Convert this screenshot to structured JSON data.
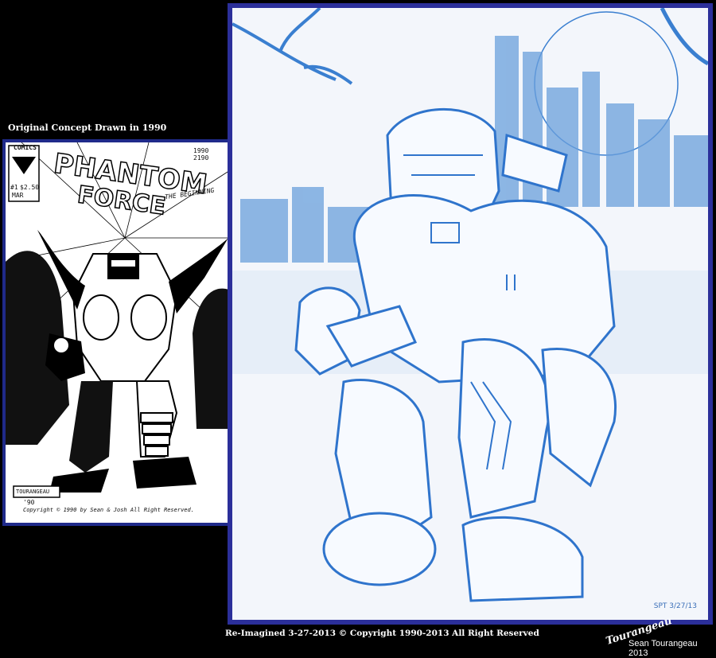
{
  "captions": {
    "top": "Original Concept Drawn in 1990",
    "bottom": "Re-Imagined 3-27-2013 © Copyright 1990-2013 All Right Reserved",
    "signature": "Tourangeau",
    "credit": "Sean Tourangeau 2013"
  },
  "original_cover": {
    "publisher": "COMICS",
    "issue_no": "#1",
    "price": "$2.50",
    "month": "MAR",
    "date_note": "1990 2190",
    "title_line1": "PHANTOM",
    "title_line2": "FORCE",
    "subtitle": "THE BEGINNING",
    "signature_box": "TOURANGEAU",
    "year_mark": "'90",
    "copyright": "Copyright © 1990 by Sean & Josh All Right Reserved."
  },
  "sketch": {
    "signature": "SPT 3/27/13"
  },
  "colors": {
    "background": "#000000",
    "frame_left": "#1f2a8a",
    "frame_right": "#2b2f9a",
    "pencil_blue": "#3a7fd0"
  }
}
